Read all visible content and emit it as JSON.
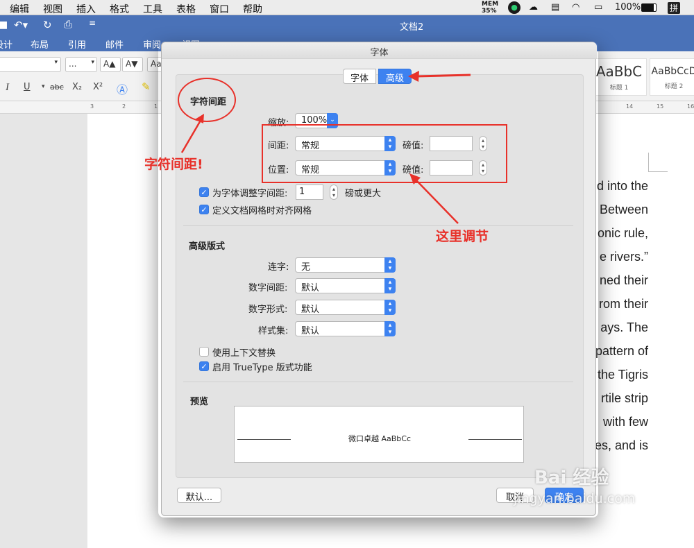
{
  "menubar": {
    "items": [
      "编辑",
      "视图",
      "插入",
      "格式",
      "工具",
      "表格",
      "窗口",
      "帮助"
    ],
    "memory_label": "MEM",
    "memory_value": "35%",
    "battery": "100%",
    "input_method": "拼"
  },
  "window": {
    "title": "文档2"
  },
  "ribbon": {
    "tabs": [
      "设计",
      "布局",
      "引用",
      "邮件",
      "审阅",
      "视图"
    ],
    "font_size_placeholder": "...",
    "grow_font": "A▲",
    "shrink_font": "A▼",
    "clear_format": "Aa",
    "italic": "I",
    "underline": "U",
    "strike": "abc",
    "subscript": "X₂",
    "superscript": "X²",
    "style_cards": [
      {
        "sample": "AaBbC",
        "name": "标题 1"
      },
      {
        "sample": "AaBbCcD",
        "name": "标题 2"
      }
    ]
  },
  "ruler": {
    "ticks_left": [
      "3",
      "2",
      "1"
    ],
    "ticks_right": [
      "14",
      "15",
      "16"
    ]
  },
  "document": {
    "lines": [
      "d into the",
      "Between",
      "onic rule,",
      "e rivers.”",
      "ned their",
      "rom their",
      "ays. The",
      "pattern of",
      "the Tigris",
      "rtile strip",
      "with few",
      "es, and is"
    ]
  },
  "dialog": {
    "title": "字体",
    "tabs": {
      "font": "字体",
      "advanced": "高级"
    },
    "char_spacing": {
      "heading": "字符间距",
      "scale_label": "缩放:",
      "scale_value": "100%",
      "spacing_label": "间距:",
      "spacing_value": "常规",
      "spacing_pts_label": "磅值:",
      "spacing_pts_value": "",
      "position_label": "位置:",
      "position_value": "常规",
      "position_pts_label": "磅值:",
      "position_pts_value": "",
      "kerning_label": "为字体调整字间距:",
      "kerning_value": "1",
      "kerning_suffix": "磅或更大",
      "kerning_checked": true,
      "grid_label": "定义文档网格时对齐网格",
      "grid_checked": true
    },
    "advanced_typography": {
      "heading": "高级版式",
      "ligatures_label": "连字:",
      "ligatures_value": "无",
      "num_spacing_label": "数字间距:",
      "num_spacing_value": "默认",
      "num_forms_label": "数字形式:",
      "num_forms_value": "默认",
      "style_sets_label": "样式集:",
      "style_sets_value": "默认",
      "contextual_label": "使用上下文替换",
      "contextual_checked": false,
      "truetype_label": "启用 TrueType 版式功能",
      "truetype_checked": true
    },
    "preview": {
      "heading": "预览",
      "sample": "微口卓越 AaBbCc"
    },
    "buttons": {
      "default": "默认...",
      "cancel": "取消",
      "ok": "确定"
    }
  },
  "annotations": {
    "char_spacing_note": "字符间距!",
    "adjust_here_note": "这里调节",
    "accent_color": "#e8312a"
  },
  "watermark": {
    "brand": "Bai 经验",
    "url": "jingyan.baidu.com"
  }
}
